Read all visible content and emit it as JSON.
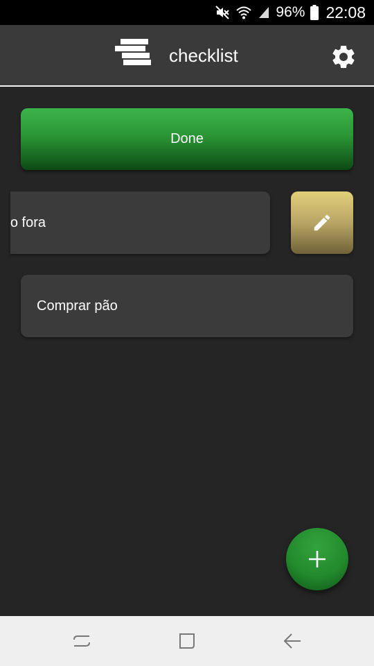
{
  "status_bar": {
    "battery_percent": "96%",
    "time": "22:08",
    "icons": [
      "mute-icon",
      "wifi-icon",
      "signal-icon",
      "battery-icon"
    ]
  },
  "app_bar": {
    "title": "checklist",
    "logo_icon": "list-logo-icon",
    "settings_icon": "gear-icon"
  },
  "main": {
    "done_label": "Done",
    "tasks": [
      {
        "label": "o fora",
        "state": "swiped-left"
      },
      {
        "label": "Comprar pão",
        "state": "normal"
      }
    ],
    "edit_icon": "pencil-icon",
    "add_icon": "plus-icon"
  },
  "nav_bar": {
    "buttons": [
      "recent-apps-icon",
      "home-icon",
      "back-icon"
    ]
  },
  "colors": {
    "background": "#252525",
    "app_bar": "#3a3a3a",
    "card": "#3b3b3b",
    "done_green": "#2a9535",
    "edit_gold": "#b9a565",
    "fab_green": "#238a2d",
    "nav_bar": "#efefef"
  }
}
